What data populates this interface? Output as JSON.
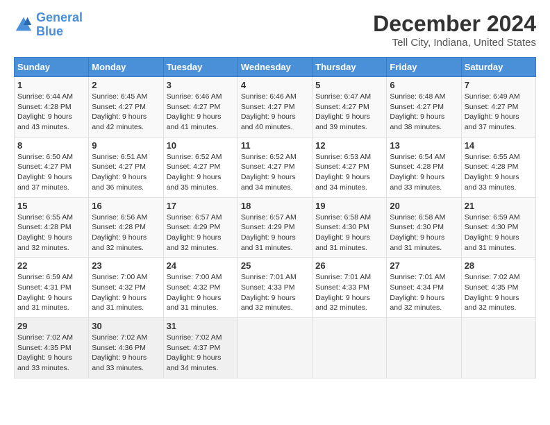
{
  "logo": {
    "line1": "General",
    "line2": "Blue"
  },
  "title": "December 2024",
  "subtitle": "Tell City, Indiana, United States",
  "days_of_week": [
    "Sunday",
    "Monday",
    "Tuesday",
    "Wednesday",
    "Thursday",
    "Friday",
    "Saturday"
  ],
  "weeks": [
    [
      {
        "day": "1",
        "sunrise": "6:44 AM",
        "sunset": "4:28 PM",
        "daylight": "9 hours and 43 minutes."
      },
      {
        "day": "2",
        "sunrise": "6:45 AM",
        "sunset": "4:27 PM",
        "daylight": "9 hours and 42 minutes."
      },
      {
        "day": "3",
        "sunrise": "6:46 AM",
        "sunset": "4:27 PM",
        "daylight": "9 hours and 41 minutes."
      },
      {
        "day": "4",
        "sunrise": "6:46 AM",
        "sunset": "4:27 PM",
        "daylight": "9 hours and 40 minutes."
      },
      {
        "day": "5",
        "sunrise": "6:47 AM",
        "sunset": "4:27 PM",
        "daylight": "9 hours and 39 minutes."
      },
      {
        "day": "6",
        "sunrise": "6:48 AM",
        "sunset": "4:27 PM",
        "daylight": "9 hours and 38 minutes."
      },
      {
        "day": "7",
        "sunrise": "6:49 AM",
        "sunset": "4:27 PM",
        "daylight": "9 hours and 37 minutes."
      }
    ],
    [
      {
        "day": "8",
        "sunrise": "6:50 AM",
        "sunset": "4:27 PM",
        "daylight": "9 hours and 37 minutes."
      },
      {
        "day": "9",
        "sunrise": "6:51 AM",
        "sunset": "4:27 PM",
        "daylight": "9 hours and 36 minutes."
      },
      {
        "day": "10",
        "sunrise": "6:52 AM",
        "sunset": "4:27 PM",
        "daylight": "9 hours and 35 minutes."
      },
      {
        "day": "11",
        "sunrise": "6:52 AM",
        "sunset": "4:27 PM",
        "daylight": "9 hours and 34 minutes."
      },
      {
        "day": "12",
        "sunrise": "6:53 AM",
        "sunset": "4:27 PM",
        "daylight": "9 hours and 34 minutes."
      },
      {
        "day": "13",
        "sunrise": "6:54 AM",
        "sunset": "4:28 PM",
        "daylight": "9 hours and 33 minutes."
      },
      {
        "day": "14",
        "sunrise": "6:55 AM",
        "sunset": "4:28 PM",
        "daylight": "9 hours and 33 minutes."
      }
    ],
    [
      {
        "day": "15",
        "sunrise": "6:55 AM",
        "sunset": "4:28 PM",
        "daylight": "9 hours and 32 minutes."
      },
      {
        "day": "16",
        "sunrise": "6:56 AM",
        "sunset": "4:28 PM",
        "daylight": "9 hours and 32 minutes."
      },
      {
        "day": "17",
        "sunrise": "6:57 AM",
        "sunset": "4:29 PM",
        "daylight": "9 hours and 32 minutes."
      },
      {
        "day": "18",
        "sunrise": "6:57 AM",
        "sunset": "4:29 PM",
        "daylight": "9 hours and 31 minutes."
      },
      {
        "day": "19",
        "sunrise": "6:58 AM",
        "sunset": "4:30 PM",
        "daylight": "9 hours and 31 minutes."
      },
      {
        "day": "20",
        "sunrise": "6:58 AM",
        "sunset": "4:30 PM",
        "daylight": "9 hours and 31 minutes."
      },
      {
        "day": "21",
        "sunrise": "6:59 AM",
        "sunset": "4:30 PM",
        "daylight": "9 hours and 31 minutes."
      }
    ],
    [
      {
        "day": "22",
        "sunrise": "6:59 AM",
        "sunset": "4:31 PM",
        "daylight": "9 hours and 31 minutes."
      },
      {
        "day": "23",
        "sunrise": "7:00 AM",
        "sunset": "4:32 PM",
        "daylight": "9 hours and 31 minutes."
      },
      {
        "day": "24",
        "sunrise": "7:00 AM",
        "sunset": "4:32 PM",
        "daylight": "9 hours and 31 minutes."
      },
      {
        "day": "25",
        "sunrise": "7:01 AM",
        "sunset": "4:33 PM",
        "daylight": "9 hours and 32 minutes."
      },
      {
        "day": "26",
        "sunrise": "7:01 AM",
        "sunset": "4:33 PM",
        "daylight": "9 hours and 32 minutes."
      },
      {
        "day": "27",
        "sunrise": "7:01 AM",
        "sunset": "4:34 PM",
        "daylight": "9 hours and 32 minutes."
      },
      {
        "day": "28",
        "sunrise": "7:02 AM",
        "sunset": "4:35 PM",
        "daylight": "9 hours and 32 minutes."
      }
    ],
    [
      {
        "day": "29",
        "sunrise": "7:02 AM",
        "sunset": "4:35 PM",
        "daylight": "9 hours and 33 minutes."
      },
      {
        "day": "30",
        "sunrise": "7:02 AM",
        "sunset": "4:36 PM",
        "daylight": "9 hours and 33 minutes."
      },
      {
        "day": "31",
        "sunrise": "7:02 AM",
        "sunset": "4:37 PM",
        "daylight": "9 hours and 34 minutes."
      },
      null,
      null,
      null,
      null
    ]
  ]
}
